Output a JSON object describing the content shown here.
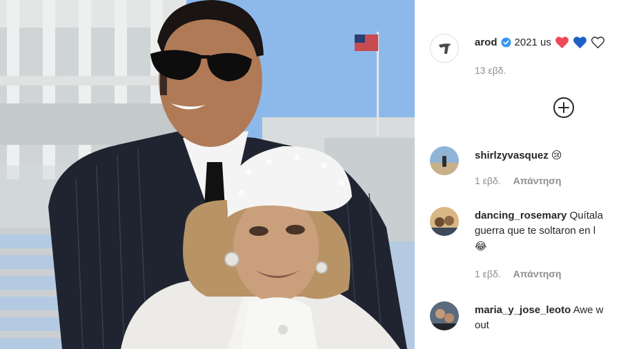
{
  "post": {
    "username": "arod",
    "caption": "2021 us",
    "time": "13 εβδ."
  },
  "comments": [
    {
      "username": "shirlzyvasquez",
      "text": "",
      "emoji": "😢",
      "time": "1 εβδ.",
      "reply_label": "Απάντηση"
    },
    {
      "username": "dancing_rosemary",
      "text": "Quítala",
      "text_line2": "guerra que te soltaron en l",
      "emoji_line3": "😂",
      "time": "1 εβδ.",
      "reply_label": "Απάντηση"
    },
    {
      "username": "maria_y_jose_leoto",
      "text": "Awe w",
      "text_line2": "out"
    }
  ],
  "colors": {
    "verified": "#3897f0",
    "heart_red": "#ed4956",
    "heart_blue": "#1c60c8",
    "meta": "#8e8e8e"
  },
  "icons": [
    "verified-badge-icon",
    "red-heart-icon",
    "blue-heart-icon",
    "white-heart-icon",
    "add-circle-icon"
  ]
}
